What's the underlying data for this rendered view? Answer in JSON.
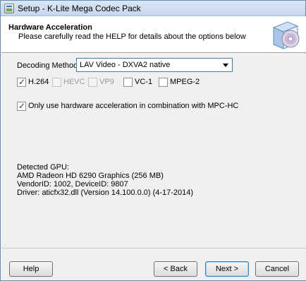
{
  "window": {
    "title": "Setup - K-Lite Mega Codec Pack"
  },
  "header": {
    "title": "Hardware Acceleration",
    "subtitle": "Please carefully read the HELP for details about the options below",
    "logo_icon": "codec-box-logo-icon"
  },
  "decoding": {
    "label": "Decoding Method:",
    "selected": "LAV Video - DXVA2 native"
  },
  "codecs": [
    {
      "label": "H.264",
      "checked": true,
      "enabled": true
    },
    {
      "label": "HEVC",
      "checked": false,
      "enabled": false
    },
    {
      "label": "VP9",
      "checked": false,
      "enabled": false
    },
    {
      "label": "VC-1",
      "checked": false,
      "enabled": true
    },
    {
      "label": "MPEG-2",
      "checked": false,
      "enabled": true
    }
  ],
  "mpc_option": {
    "label": "Only use hardware acceleration in combination with MPC-HC",
    "checked": true
  },
  "gpu": {
    "heading": "Detected GPU:",
    "name": "AMD Radeon HD 6290 Graphics (256 MB)",
    "ids": "VendorID: 1002, DeviceID: 9807",
    "driver": "Driver: aticfx32.dll (Version 14.100.0.0) (4-17-2014)"
  },
  "buttons": {
    "help": "Help",
    "back": "< Back",
    "next": "Next >",
    "cancel": "Cancel"
  },
  "colors": {
    "accent": "#3c7fb1",
    "disabled_text": "#9a9a9a"
  }
}
